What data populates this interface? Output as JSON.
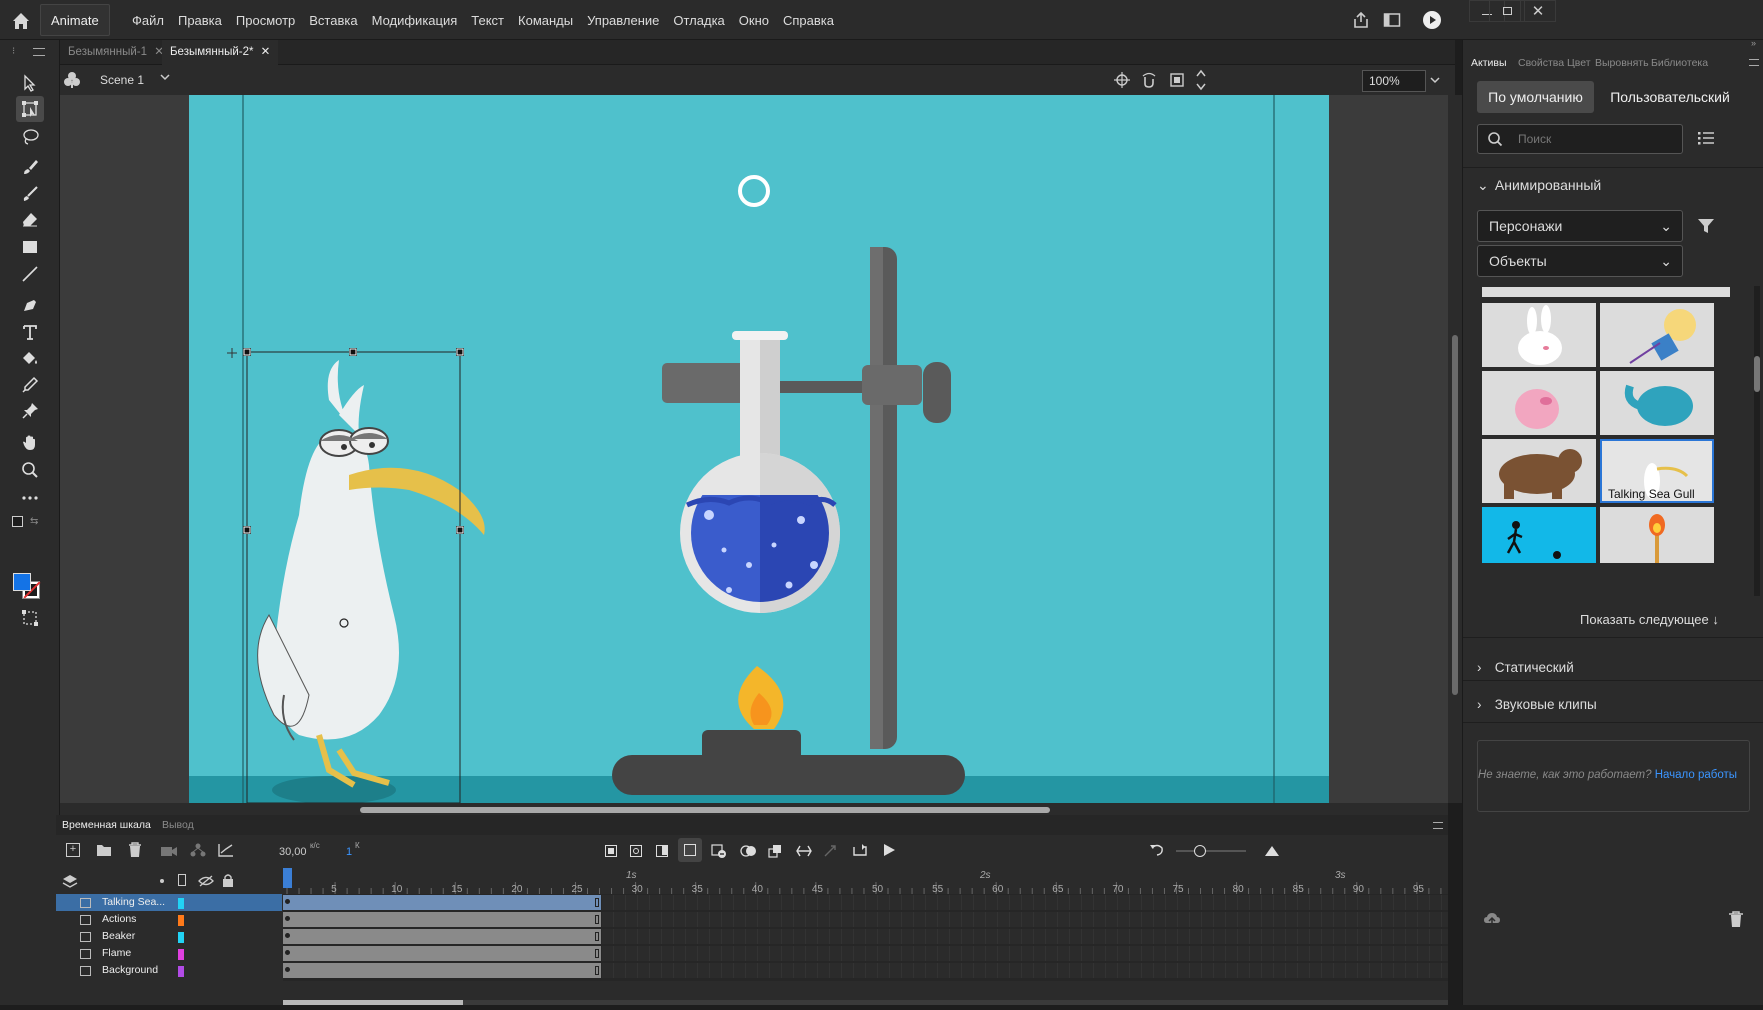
{
  "app": {
    "name": "Animate"
  },
  "menu": [
    "Файл",
    "Правка",
    "Просмотр",
    "Вставка",
    "Модификация",
    "Текст",
    "Команды",
    "Управление",
    "Отладка",
    "Окно",
    "Справка"
  ],
  "doc_tabs": [
    {
      "label": "Безымянный-1",
      "active": false
    },
    {
      "label": "Безымянный-2*",
      "active": true
    }
  ],
  "scene": {
    "label": "Scene 1",
    "zoom": "100%"
  },
  "right_panel": {
    "tabs": [
      "Активы",
      "Свойства",
      "Цвет",
      "Выровнять",
      "Библиотека"
    ],
    "btn_default": "По умолчанию",
    "btn_custom": "Пользовательский",
    "search_placeholder": "Поиск",
    "section_animated": "Анимированный",
    "dd_characters": "Персонажи",
    "dd_objects": "Объекты",
    "selected_thumb_label": "Talking Sea Gull",
    "show_next": "Показать следующее ↓",
    "section_static": "Статический",
    "section_sound": "Звуковые клипы",
    "help_text": "Не знаете, как это работает?",
    "help_link": "Начало работы"
  },
  "timeline": {
    "tabs": [
      "Временная шкала",
      "Вывод"
    ],
    "fps_value": "30,00",
    "fps_unit": "к/с",
    "frame_value": "1",
    "frame_unit": "К",
    "seconds": [
      "1s",
      "2s",
      "3s"
    ],
    "ticks": [
      "5",
      "10",
      "15",
      "20",
      "25",
      "30",
      "35",
      "40",
      "45",
      "50",
      "55",
      "60",
      "65",
      "70",
      "75",
      "80",
      "85",
      "90",
      "95"
    ],
    "layers": [
      {
        "name": "Talking Sea...",
        "color": "#22d3f5",
        "selected": true
      },
      {
        "name": "Actions",
        "color": "#ff7a1a",
        "selected": false
      },
      {
        "name": "Beaker",
        "color": "#22d3f5",
        "selected": false
      },
      {
        "name": "Flame",
        "color": "#e040e0",
        "selected": false
      },
      {
        "name": "Background",
        "color": "#b24be6",
        "selected": false
      }
    ]
  },
  "colors": {
    "stage": "#4fc1cc",
    "accent": "#2b76d6",
    "fill_swatch": "#1473e6"
  }
}
